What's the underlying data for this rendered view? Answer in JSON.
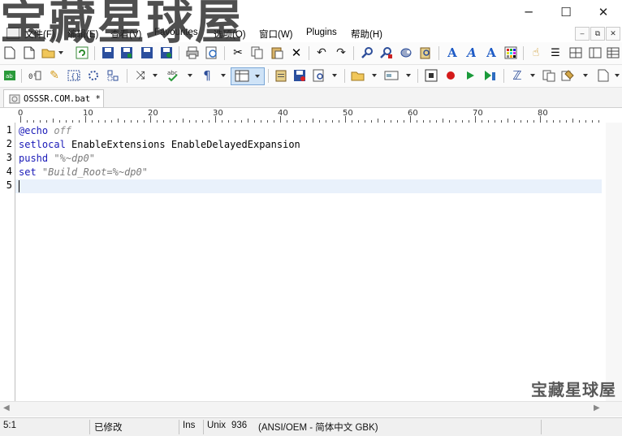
{
  "window": {
    "minimize": "─",
    "maximize": "☐",
    "close": "✕"
  },
  "watermark": {
    "top": "宝藏星球屋",
    "bottom_right": "宝藏星球屋"
  },
  "menu": {
    "items": [
      "文件(F)",
      "编辑(E)",
      "查看(V)",
      "Favourites",
      "选项(O)",
      "窗口(W)",
      "Plugins",
      "帮助(H)"
    ],
    "mdi_controls": [
      "‒",
      "⧉",
      "✕"
    ]
  },
  "tab": {
    "title": "OSSSR.COM.bat *"
  },
  "ruler": {
    "labels": [
      "0",
      "10",
      "20",
      "30",
      "40",
      "50",
      "60",
      "70",
      "80"
    ]
  },
  "editor": {
    "line_numbers": [
      "1",
      "2",
      "3",
      "4",
      "5"
    ],
    "lines": [
      [
        {
          "t": "@echo",
          "c": "kw"
        },
        {
          "t": " "
        },
        {
          "t": "off",
          "c": "off"
        }
      ],
      [
        {
          "t": "setlocal",
          "c": "kw"
        },
        {
          "t": " EnableExtensions EnableDelayedExpansion"
        }
      ],
      [
        {
          "t": "pushd",
          "c": "kw"
        },
        {
          "t": " "
        },
        {
          "t": "\"%~dp0\"",
          "c": "str"
        }
      ],
      [
        {
          "t": "set",
          "c": "kw"
        },
        {
          "t": " "
        },
        {
          "t": "\"Build_Root=%~dp0\"",
          "c": "str"
        }
      ],
      []
    ]
  },
  "statusbar": {
    "position": "5:1",
    "modified": "已修改",
    "ins": "Ins",
    "lineend": "Unix",
    "codepage": "936",
    "encoding": "(ANSI/OEM - 简体中文 GBK)"
  },
  "toolbar1": {
    "icons": [
      "new-file-icon",
      "new-template-icon",
      "open-folder-icon",
      "reload-icon",
      "save-icon",
      "save-as-icon",
      "save-all-icon",
      "save-special-icon",
      "print-icon",
      "print-preview-icon",
      "cut-icon",
      "copy-icon",
      "paste-icon",
      "delete-icon",
      "undo-icon",
      "redo-icon",
      "find-icon",
      "find-in-files-icon",
      "replace-icon",
      "find-in-files-replace-icon",
      "font-a-blue-icon",
      "font-a-italic-icon",
      "font-a-color-icon",
      "color-grid-icon",
      "hand-icon",
      "list-icon",
      "layout-h-icon",
      "layout-v-icon",
      "layout-grid-icon"
    ]
  },
  "toolbar2": {
    "icons": [
      "shell-icon",
      "counter-icon",
      "pencil-icon",
      "bracket-icon",
      "refresh-dots-icon",
      "column-icon",
      "merge-icon",
      "spellcheck-icon",
      "pilcrow-icon",
      "column-mode-icon",
      "clipboard-icon",
      "save-macro-icon",
      "zoom-icon",
      "folder-browse-icon",
      "ftp-icon",
      "record-stop-icon",
      "record-icon",
      "play-icon",
      "play-multi-icon",
      "script-icon",
      "compare-icon",
      "project-icon",
      "page-icon"
    ]
  },
  "colors": {
    "keyword": "#1a1ab8",
    "comment": "#8c8c8c",
    "current_line": "#e9f1fb"
  }
}
